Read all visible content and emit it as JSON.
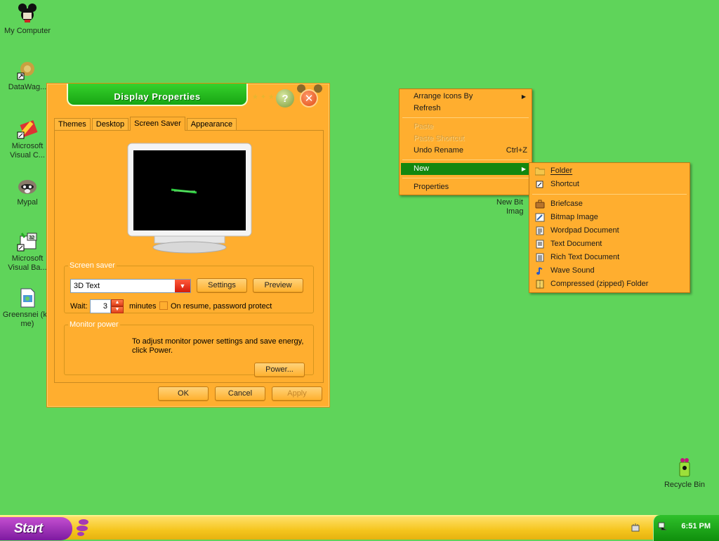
{
  "desktop": {
    "icons": [
      {
        "label": "My Computer",
        "icon": "mickey-computer-icon"
      },
      {
        "label": "DataWag...",
        "icon": "datawag-shortcut-icon"
      },
      {
        "label": "Microsoft Visual C...",
        "icon": "visual-c-shortcut-icon"
      },
      {
        "label": "Mypal",
        "icon": "mypal-raccoon-icon"
      },
      {
        "label": "Microsoft Visual Ba...",
        "icon": "visual-basic-shortcut-icon"
      },
      {
        "label": "Greensnei (kill me)",
        "icon": "document-icon"
      },
      {
        "label": "Recycle Bin",
        "icon": "recycle-bin-icon"
      }
    ],
    "partial_file_label_1": "New Bit",
    "partial_file_label_2": "Imag"
  },
  "window": {
    "title": "Display Properties",
    "tabs": [
      "Themes",
      "Desktop",
      "Screen Saver",
      "Appearance"
    ],
    "active_tab": "Screen Saver",
    "screensaver_group": {
      "legend": "Screen saver",
      "selected": "3D Text",
      "settings_label": "Settings",
      "preview_label": "Preview",
      "wait_label": "Wait:",
      "wait_value": "3",
      "minutes_label": "minutes",
      "password_label": "On resume, password protect",
      "password_checked": false
    },
    "monitor_group": {
      "legend": "Monitor power",
      "description": "To adjust monitor power settings and save energy, click Power.",
      "power_label": "Power..."
    },
    "footer": {
      "ok": "OK",
      "cancel": "Cancel",
      "apply": "Apply"
    }
  },
  "context_menu": {
    "items": [
      {
        "label": "Arrange Icons By",
        "submenu": true,
        "disabled": false
      },
      {
        "label": "Refresh",
        "submenu": false,
        "disabled": false
      },
      {
        "label": "Paste",
        "submenu": false,
        "disabled": true
      },
      {
        "label": "Paste Shortcut",
        "submenu": false,
        "disabled": true
      },
      {
        "label": "Undo Rename",
        "shortcut": "Ctrl+Z",
        "submenu": false,
        "disabled": false
      },
      {
        "label": "New",
        "submenu": true,
        "disabled": false,
        "highlighted": true
      },
      {
        "label": "Properties",
        "submenu": false,
        "disabled": false
      }
    ]
  },
  "new_submenu": {
    "items": [
      {
        "label": "Folder",
        "icon": "folder-icon"
      },
      {
        "label": "Shortcut",
        "icon": "shortcut-icon"
      },
      {
        "label": "Briefcase",
        "icon": "briefcase-icon"
      },
      {
        "label": "Bitmap Image",
        "icon": "bitmap-icon"
      },
      {
        "label": "Wordpad Document",
        "icon": "wordpad-icon"
      },
      {
        "label": "Text Document",
        "icon": "text-document-icon"
      },
      {
        "label": "Rich Text Document",
        "icon": "rich-text-icon"
      },
      {
        "label": "Wave Sound",
        "icon": "wave-sound-icon"
      },
      {
        "label": "Compressed (zipped) Folder",
        "icon": "zip-folder-icon"
      }
    ]
  },
  "taskbar": {
    "start_label": "Start",
    "clock": "6:51 PM"
  },
  "colors": {
    "desktop_bg": "#5fd45a",
    "window_bg": "#ffae2f",
    "title_green": "#17a513",
    "menu_highlight": "#13870f",
    "start_purple": "#7d1aa0",
    "taskbar_yellow": "#f5c51d"
  }
}
